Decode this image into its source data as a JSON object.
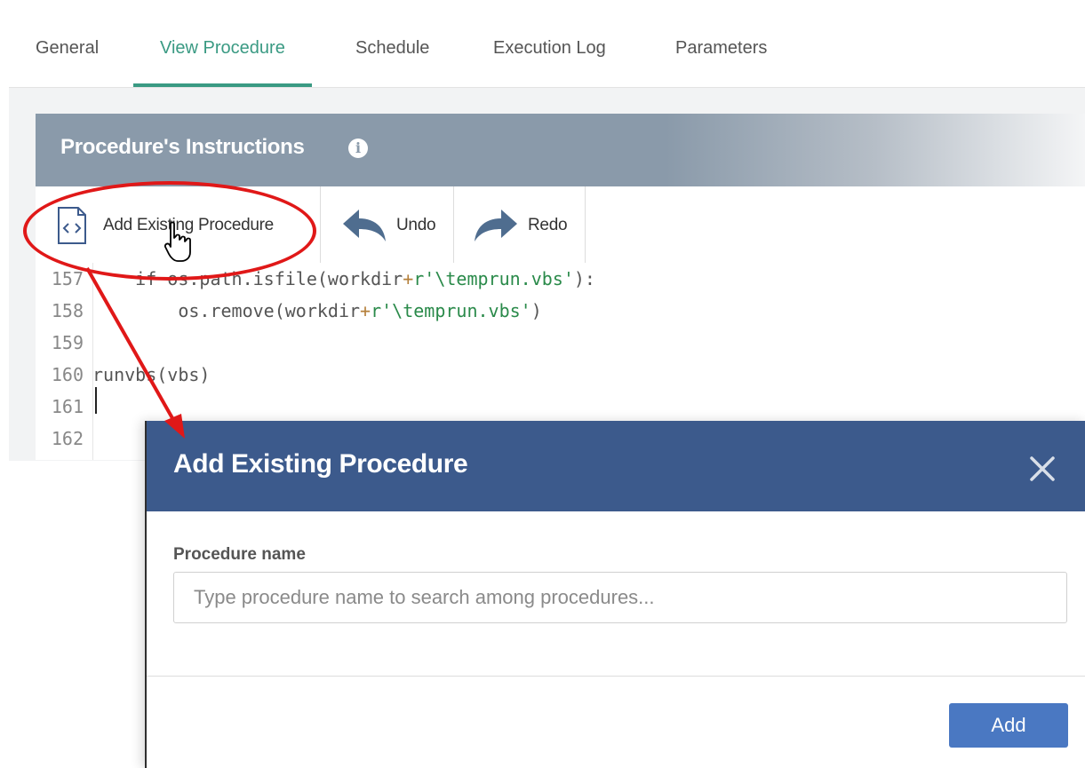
{
  "tabs": [
    {
      "label": "General",
      "active": false
    },
    {
      "label": "View Procedure",
      "active": true
    },
    {
      "label": "Schedule",
      "active": false
    },
    {
      "label": "Execution Log",
      "active": false
    },
    {
      "label": "Parameters",
      "active": false
    }
  ],
  "panel": {
    "title": "Procedure's Instructions",
    "info_icon": "info-icon"
  },
  "toolbar": {
    "add_existing_label": "Add Existing Procedure",
    "undo_label": "Undo",
    "redo_label": "Redo"
  },
  "code": {
    "lines": [
      {
        "num": "157",
        "text_a": "    if os.path.isfile(workdir",
        "plus": "+",
        "str": "r'\\temprun.vbs'",
        "text_b": "):"
      },
      {
        "num": "158",
        "text_a": "        os.remove(workdir",
        "plus": "+",
        "str": "r'\\temprun.vbs'",
        "text_b": ")"
      },
      {
        "num": "159",
        "text_a": "",
        "plus": "",
        "str": "",
        "text_b": ""
      },
      {
        "num": "160",
        "text_a": "runvbs(vbs)",
        "plus": "",
        "str": "",
        "text_b": ""
      },
      {
        "num": "161",
        "text_a": "",
        "plus": "",
        "str": "",
        "text_b": ""
      },
      {
        "num": "162",
        "text_a": "",
        "plus": "",
        "str": "",
        "text_b": ""
      }
    ]
  },
  "modal": {
    "title": "Add Existing Procedure",
    "field_label": "Procedure name",
    "field_placeholder": "Type procedure name to search among procedures...",
    "field_value": "",
    "add_label": "Add"
  },
  "colors": {
    "accent_green": "#3a9a83",
    "modal_header": "#3c5a8c",
    "add_button": "#4a78c2",
    "annotation_red": "#e01818"
  }
}
